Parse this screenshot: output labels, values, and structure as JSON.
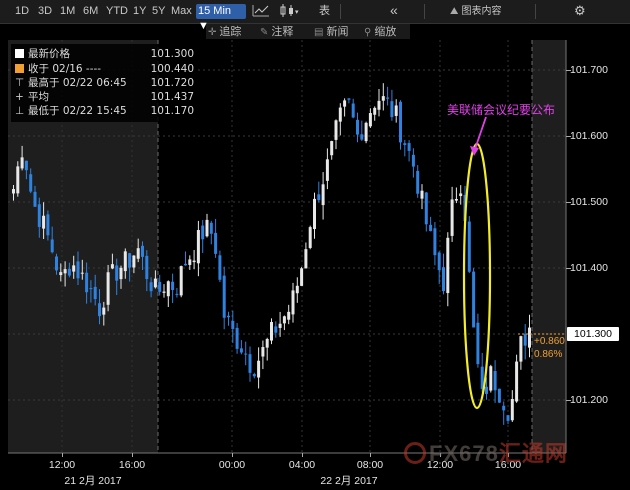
{
  "toolbar": {
    "periods": [
      "1D",
      "3D",
      "1M",
      "6M",
      "YTD",
      "1Y",
      "5Y",
      "Max"
    ],
    "interval": "15 Min ▼",
    "table_label": "表",
    "collapse_icon": "«",
    "chart_content_label": "图表内容",
    "gear_icon": "⚙"
  },
  "subtoolbar": {
    "track_label": "追踪",
    "annotate_label": "注释",
    "news_label": "新闻",
    "zoom_label": "缩放"
  },
  "legend": {
    "rows": [
      {
        "label": "最新价格",
        "value": "101.300"
      },
      {
        "label": "收于 02/16 ----",
        "value": "100.440"
      },
      {
        "label": "最高于 02/22 06:45",
        "value": "101.720"
      },
      {
        "label": "平均",
        "value": "101.437"
      },
      {
        "label": "最低于 02/22 15:45",
        "value": "101.170"
      }
    ]
  },
  "annotation": {
    "text": "美联储会议纪要公布",
    "color": "#e040e8"
  },
  "last": {
    "price": "101.300",
    "change": "+0.860",
    "pct": "0.86%"
  },
  "watermark": {
    "text1": "FX678",
    "text2": "汇通网"
  },
  "colors": {
    "up": "#e8e8e8",
    "down": "#2f82e0",
    "ellipse": "#f2ec2a",
    "bg": "#000000",
    "shade": "#1e1e1e"
  },
  "chart_data": {
    "type": "candlestick",
    "ylim": [
      101.11,
      101.79
    ],
    "y_ticks": [
      "101.200",
      "101.300",
      "101.400",
      "101.500",
      "101.600",
      "101.700"
    ],
    "x_ticks": [
      "12:00",
      "16:00",
      "00:00",
      "04:00",
      "08:00",
      "12:00",
      "16:00"
    ],
    "x_date_labels": [
      "21 2月 2017",
      "22 2月 2017"
    ],
    "grid": true,
    "legend_position": "top-left",
    "last_price": 101.3,
    "high": 101.72,
    "low": 101.17,
    "average": 101.437,
    "prev_close": 100.44,
    "close_anchors": [
      101.52,
      101.59,
      101.5,
      101.47,
      101.43,
      101.38,
      101.41,
      101.39,
      101.37,
      101.34,
      101.38,
      101.4,
      101.41,
      101.43,
      101.39,
      101.36,
      101.38,
      101.37,
      101.41,
      101.43,
      101.46,
      101.45,
      101.33,
      101.3,
      101.28,
      101.25,
      101.27,
      101.3,
      101.32,
      101.34,
      101.39,
      101.47,
      101.52,
      101.56,
      101.62,
      101.65,
      101.6,
      101.63,
      101.66,
      101.65,
      101.63,
      101.59,
      101.55,
      101.48,
      101.42,
      101.38,
      101.5,
      101.54,
      101.32,
      101.2,
      101.24,
      101.21,
      101.18,
      101.28,
      101.31
    ]
  }
}
